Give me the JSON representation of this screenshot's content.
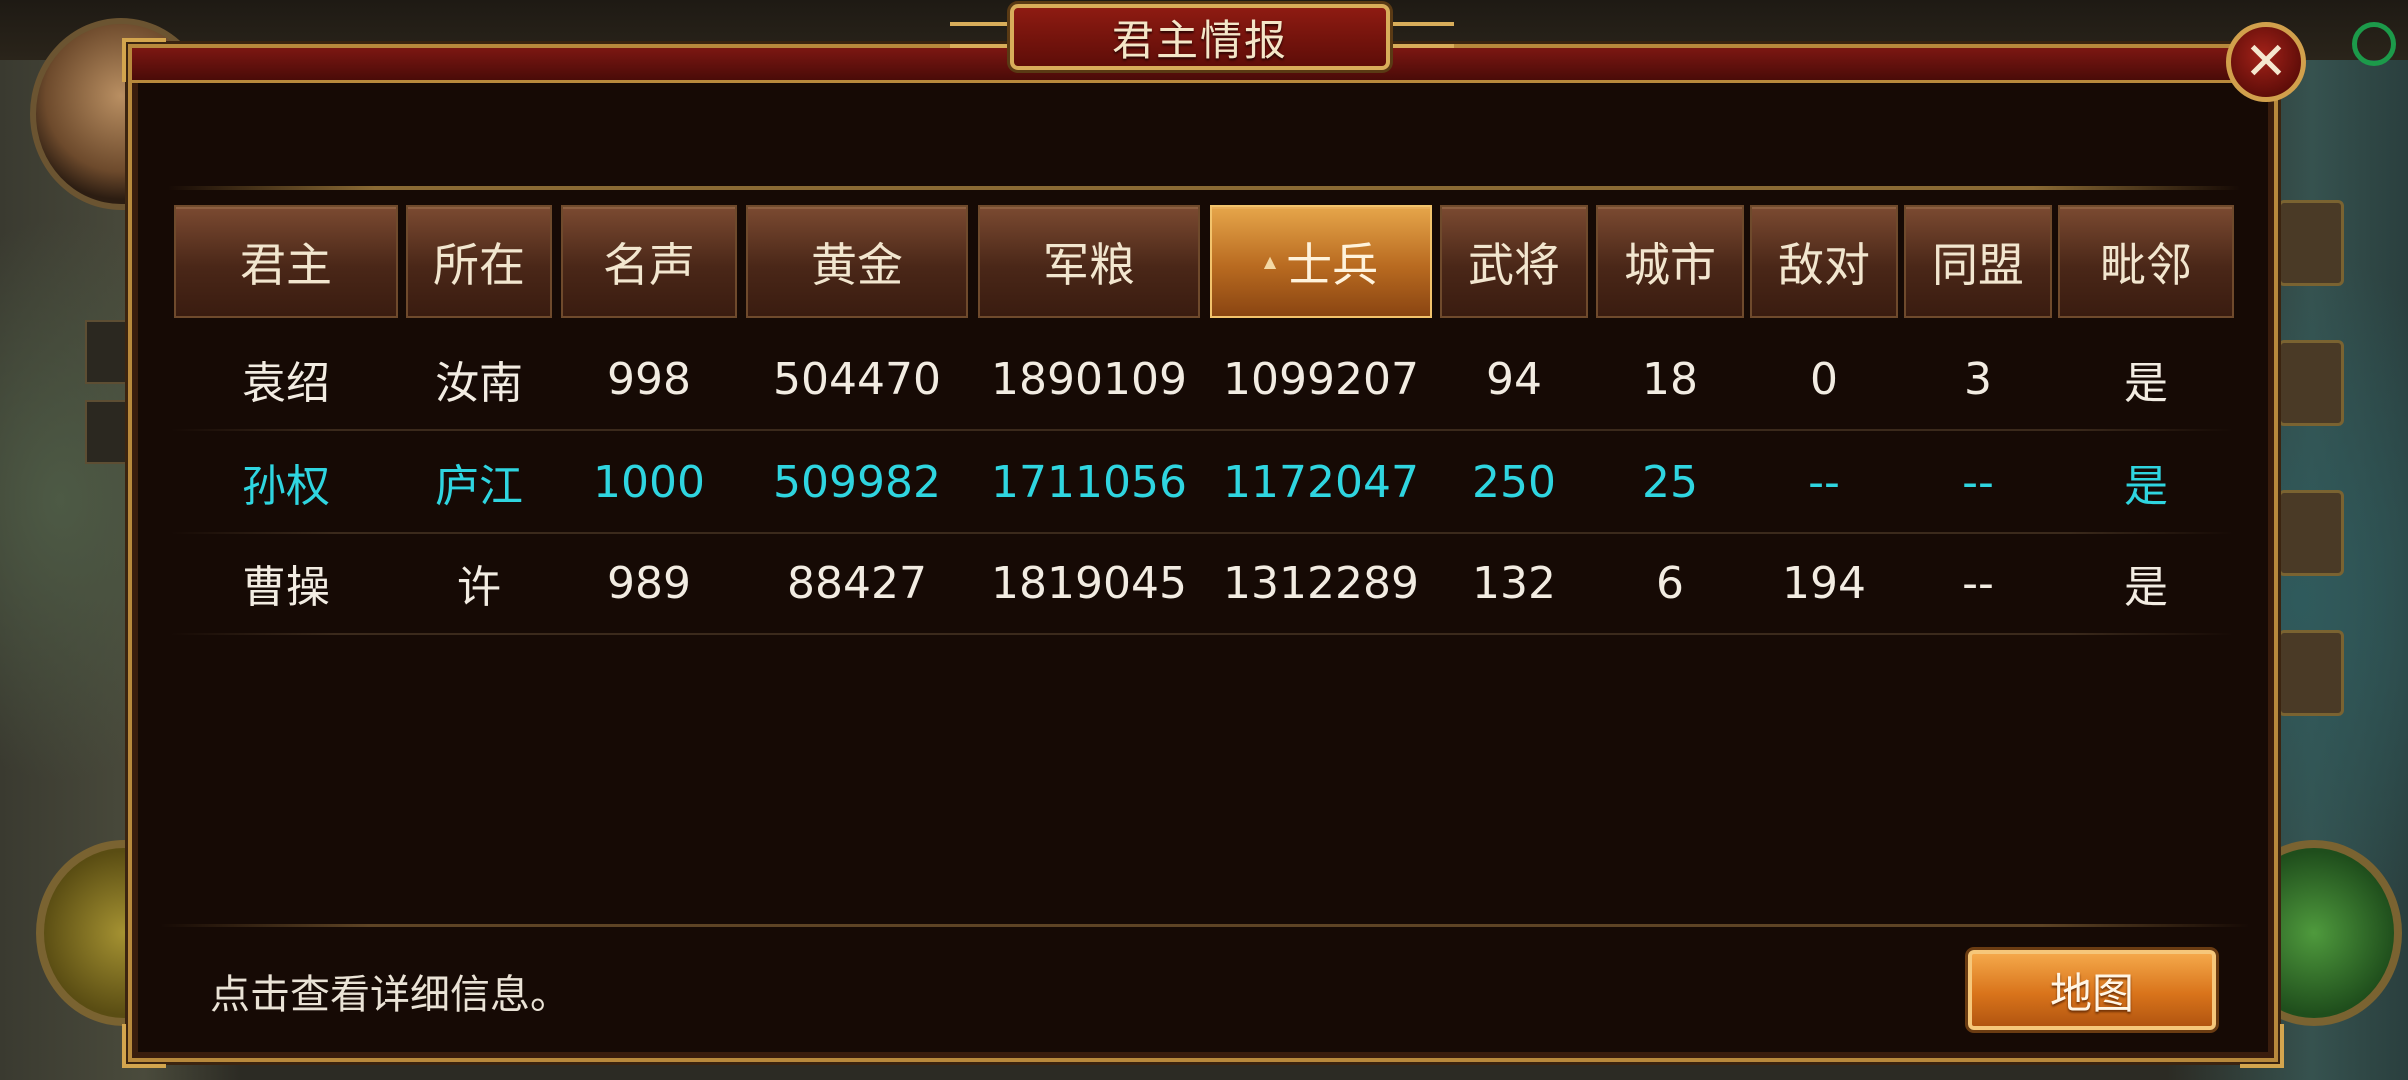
{
  "dialog": {
    "title": "君主情报",
    "close_glyph": "✕",
    "hint": "点击查看详细信息。",
    "map_button": "地图"
  },
  "table": {
    "sorted_column": "士兵",
    "sort_glyph": "▲",
    "headers": [
      "君主",
      "所在",
      "名声",
      "黄金",
      "军粮",
      "士兵",
      "武将",
      "城市",
      "敌对",
      "同盟",
      "毗邻"
    ],
    "rows": [
      [
        "袁绍",
        "汝南",
        "998",
        "504470",
        "1890109",
        "1099207",
        "94",
        "18",
        "0",
        "3",
        "是"
      ],
      [
        "孙权",
        "庐江",
        "1000",
        "509982",
        "1711056",
        "1172047",
        "250",
        "25",
        "--",
        "--",
        "是"
      ],
      [
        "曹操",
        "许",
        "989",
        "88427",
        "1819045",
        "1312289",
        "132",
        "6",
        "194",
        "--",
        "是"
      ]
    ],
    "highlight_row": 1
  },
  "colors": {
    "highlight_text": "#2fd5e0",
    "header_active": "#d9741b",
    "frame_gold": "#b8893c",
    "title_red": "#8e1b12"
  },
  "icons": {
    "close": "close-icon",
    "sort": "sort-asc-icon"
  }
}
